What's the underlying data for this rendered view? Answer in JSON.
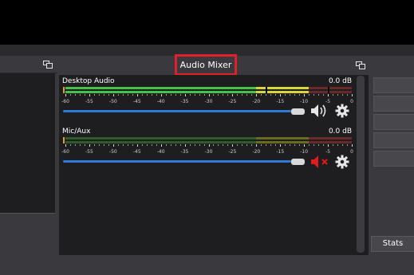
{
  "dock": {
    "title": "Audio Mixer",
    "stats_label": "Stats"
  },
  "scale": [
    "-60",
    "-55",
    "-50",
    "-45",
    "-40",
    "-35",
    "-30",
    "-25",
    "-20",
    "-15",
    "-10",
    "-5",
    "0"
  ],
  "channels": [
    {
      "name": "Desktop Audio",
      "db": "0.0 dB",
      "muted": false,
      "volume": 1.0,
      "level_db": -9
    },
    {
      "name": "Mic/Aux",
      "db": "0.0 dB",
      "muted": true,
      "volume": 1.0,
      "level_db": -60
    }
  ],
  "colors": {
    "meter_green": "#46c247",
    "meter_yellow": "#d9d63a",
    "meter_red": "#c83a3a",
    "meter_green_dim": "#2f5a2a",
    "meter_yellow_dim": "#6b6a22",
    "meter_red_dim": "#6a2a2a",
    "slider": "#2d7bd6",
    "mute_red": "#e01b1b",
    "highlight_border": "#e0202a"
  },
  "icons": {
    "speaker": "speaker-icon",
    "speaker_muted": "speaker-muted-icon",
    "gear": "gear-icon",
    "float": "float-dock-icon"
  }
}
